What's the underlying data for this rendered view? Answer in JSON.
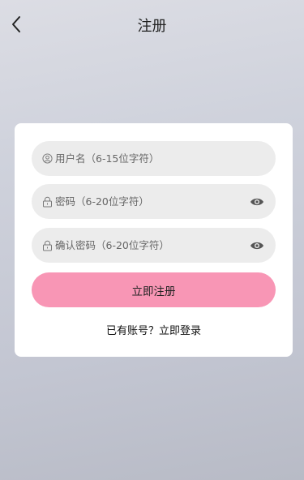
{
  "header": {
    "title": "注册",
    "back_icon": "chevron-left-icon"
  },
  "form": {
    "username": {
      "placeholder": "用户名（6-15位字符）",
      "value": "",
      "icon": "user-circle-icon"
    },
    "password": {
      "placeholder": "密码（6-20位字符）",
      "value": "",
      "icon": "lock-icon",
      "toggle_icon": "eye-icon"
    },
    "confirm_password": {
      "placeholder": "确认密码（6-20位字符）",
      "value": "",
      "icon": "lock-icon",
      "toggle_icon": "eye-icon"
    },
    "submit_label": "立即注册",
    "login_link": "已有账号？立即登录"
  },
  "colors": {
    "accent": "#f896b5",
    "card": "#ffffff",
    "field_bg": "#ececec"
  }
}
